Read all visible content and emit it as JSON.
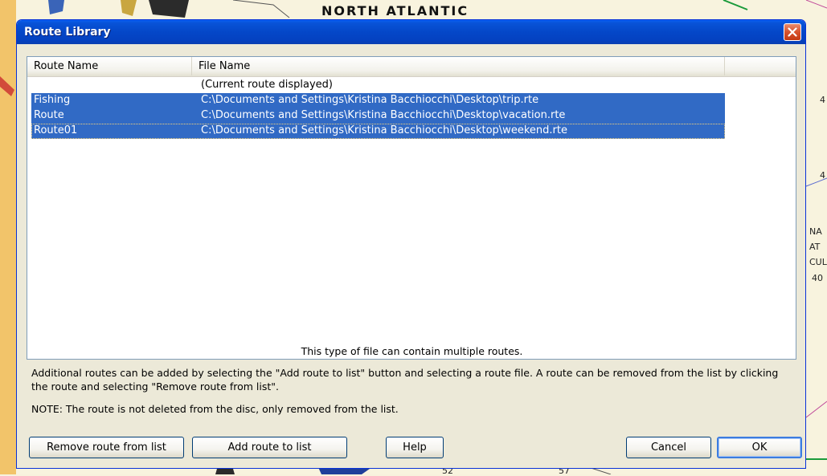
{
  "background_map": {
    "region_label": "NORTH ATLANTIC",
    "labels": [
      "NA",
      "AT",
      "CUL",
      "40",
      "4",
      "4",
      "52",
      "57"
    ]
  },
  "dialog": {
    "title": "Route Library",
    "columns": {
      "route_name": "Route Name",
      "file_name": "File Name"
    },
    "rows": [
      {
        "name": "",
        "file": "(Current route displayed)",
        "selected": false
      },
      {
        "name": "Fishing",
        "file": "C:\\Documents and Settings\\Kristina Bacchiocchi\\Desktop\\trip.rte",
        "selected": true
      },
      {
        "name": "Route",
        "file": "C:\\Documents and Settings\\Kristina Bacchiocchi\\Desktop\\vacation.rte",
        "selected": true
      },
      {
        "name": "Route01",
        "file": "C:\\Documents and Settings\\Kristina Bacchiocchi\\Desktop\\weekend.rte",
        "selected": true
      }
    ],
    "info_center": "This type of file can contain multiple routes.",
    "info_paragraph": "Additional routes can be added by selecting the \"Add route to list\" button and selecting a route file. A route can be removed from the list by clicking the route and selecting \"Remove route from list\".",
    "info_note": "NOTE: The route is not deleted from the disc, only removed from the list.",
    "buttons": {
      "remove": "Remove route from list",
      "add": "Add route to list",
      "help": "Help",
      "cancel": "Cancel",
      "ok": "OK"
    }
  },
  "colors": {
    "titlebar": "#0447c8",
    "selection": "#316ac5",
    "dialog_face": "#ece9d8",
    "close_button": "#d8522c"
  }
}
